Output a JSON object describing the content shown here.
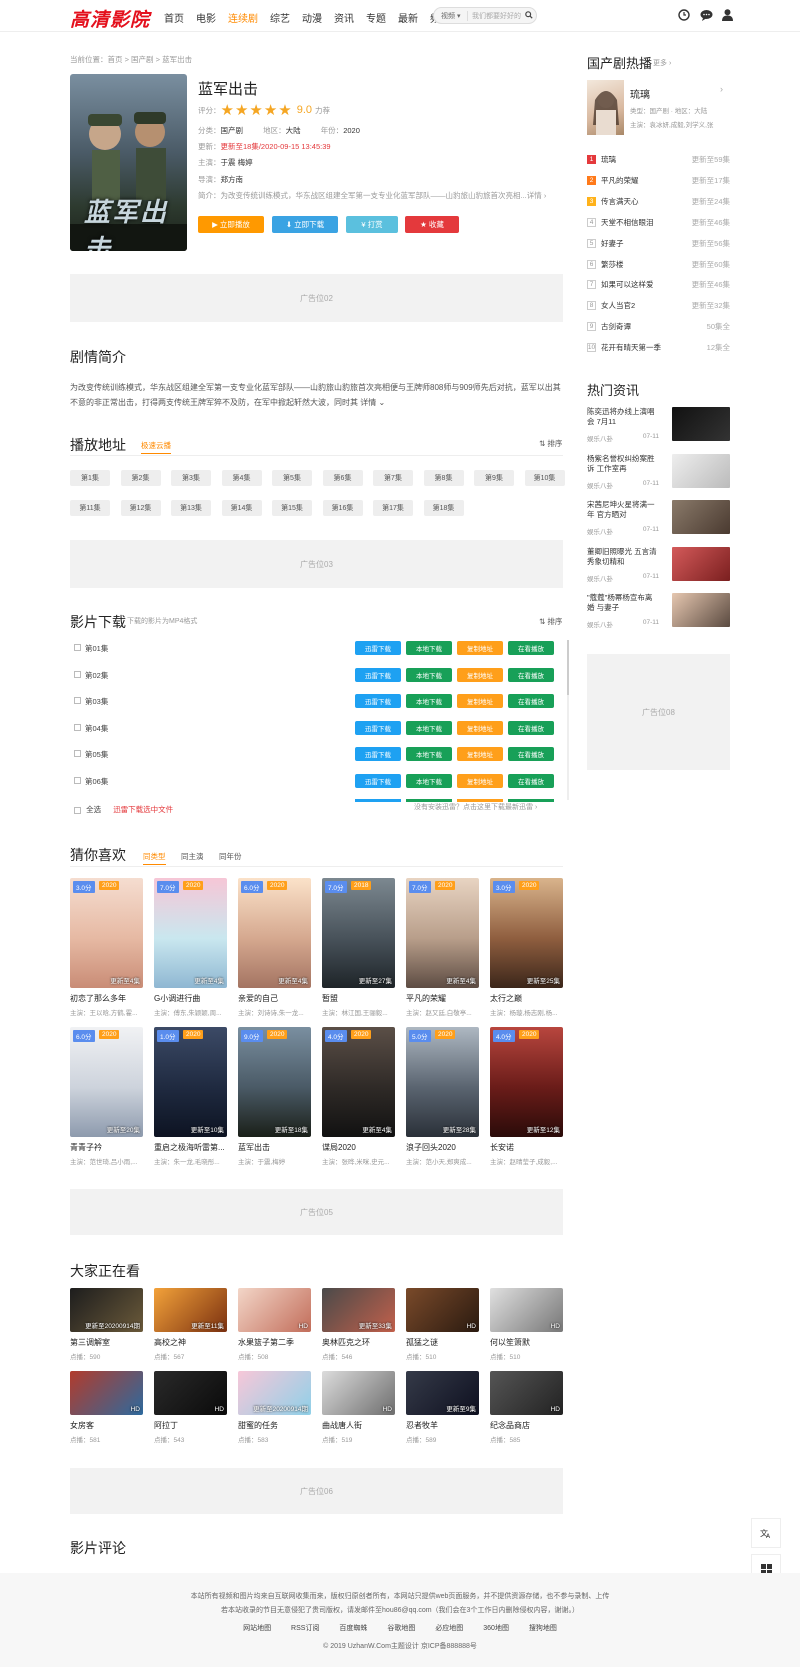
{
  "header": {
    "logo": "高清影院",
    "nav": [
      "首页",
      "电影",
      "连续剧",
      "综艺",
      "动漫",
      "资讯",
      "专题",
      "最新",
      "频道"
    ],
    "search_type": "视频",
    "search_placeholder": "我们都要好好的"
  },
  "breadcrumb": {
    "text": "当前位置：首页 > 国产剧 > 蓝军出击"
  },
  "movie": {
    "title": "蓝军出击",
    "rating_label": "评分：",
    "score": "9.0",
    "score_suffix": "力荐",
    "stars_filled": 5,
    "category_label": "分类：",
    "category": "国产剧",
    "region_label": "地区：",
    "region": "大陆",
    "year_label": "年份：",
    "year": "2020",
    "update_label": "更新：",
    "update": "更新至18集/2020-09-15 13:45:39",
    "cast_label": "主演：",
    "cast": "于震 梅婷",
    "director_label": "导演：",
    "director": "郑方南",
    "intro_label": "简介：",
    "intro": "为改变传统训练模式，华东战区组建全军第一支专业化蓝军部队——山豹旅山豹旅首次亮相...详情 ›",
    "poster_title": "蓝军出击"
  },
  "buttons": {
    "play": "▶ 立即播放",
    "download": "⬇ 立即下载",
    "tip": "¥ 打赏",
    "fav": "★ 收藏"
  },
  "ads": {
    "ad02": "广告位02",
    "ad03": "广告位03",
    "ad05": "广告位05",
    "ad06": "广告位06",
    "ad08": "广告位08"
  },
  "synopsis": {
    "heading": "剧情简介",
    "text": "为改变传统训练模式，华东战区组建全军第一支专业化蓝军部队——山豹旅山豹旅首次亮相便与王牌师808师与909师先后对抗，蓝军以出其不意的非正常出击，打得两支传统王牌军猝不及防，在军中掀起轩然大波，同时其 详情 ⌄"
  },
  "play": {
    "heading": "播放地址",
    "source": "极速云播",
    "sort": "⇅ 排序",
    "episodes": [
      "第1集",
      "第2集",
      "第3集",
      "第4集",
      "第5集",
      "第6集",
      "第7集",
      "第8集",
      "第9集",
      "第10集",
      "第11集",
      "第12集",
      "第13集",
      "第14集",
      "第15集",
      "第16集",
      "第17集",
      "第18集"
    ]
  },
  "download": {
    "heading": "影片下载",
    "note": "下载的影片为MP4格式",
    "sort": "⇅ 排序",
    "items": [
      "第01集",
      "第02集",
      "第03集",
      "第04集",
      "第05集",
      "第06集"
    ],
    "btn_xl": "迅雷下载",
    "btn_local": "本地下载",
    "btn_copy": "复制地址",
    "btn_watch": "在看播放",
    "select_all": "全选",
    "batch": "迅雷下载选中文件",
    "footer_note": "没有安装迅雷？点击这里下载最新迅雷 ›"
  },
  "guess": {
    "heading": "猜你喜欢",
    "tabs": [
      "同类型",
      "同主演",
      "同年份"
    ],
    "items": [
      {
        "score": "3.0分",
        "year": "2020",
        "status": "更新至4集",
        "name": "初恋了那么多年",
        "actors": "主演：王以晗,方鹤,霍..."
      },
      {
        "score": "7.0分",
        "year": "2020",
        "status": "更新至4集",
        "name": "G小调进行曲",
        "actors": "主演：傅东,朱颖颖,周..."
      },
      {
        "score": "6.0分",
        "year": "2020",
        "status": "更新至4集",
        "name": "亲爱的自己",
        "actors": "主演：刘诗诗,朱一龙..."
      },
      {
        "score": "7.0分",
        "year": "2018",
        "status": "更新至27集",
        "name": "暂盟",
        "actors": "主演：林江国,王骊毅..."
      },
      {
        "score": "7.0分",
        "year": "2020",
        "status": "更新至4集",
        "name": "平凡的荣耀",
        "actors": "主演：赵又廷,白敬亭..."
      },
      {
        "score": "3.0分",
        "year": "2020",
        "status": "更新至25集",
        "name": "太行之巅",
        "actors": "主演：杨璇,杨志刚,杨..."
      },
      {
        "score": "6.0分",
        "year": "2020",
        "status": "更新至20集",
        "name": "青青子衿",
        "actors": "主演：范世琦,吕小雨,..."
      },
      {
        "score": "1.0分",
        "year": "2020",
        "status": "更新至10集",
        "name": "重启之极海听雷第...",
        "actors": "主演：朱一龙,毛晓彤..."
      },
      {
        "score": "9.0分",
        "year": "2020",
        "status": "更新至18集",
        "name": "蓝军出击",
        "actors": "主演：于震,梅婷"
      },
      {
        "score": "4.0分",
        "year": "2020",
        "status": "更新至4集",
        "name": "谍局2020",
        "actors": "主演：张晔,米咪,史元..."
      },
      {
        "score": "5.0分",
        "year": "2020",
        "status": "更新至28集",
        "name": "浪子回头2020",
        "actors": "主演：范小天,郑爽成..."
      },
      {
        "score": "4.0分",
        "year": "2020",
        "status": "更新至12集",
        "name": "长安诺",
        "actors": "主演：赵晴莹子,成毅,..."
      }
    ]
  },
  "watching": {
    "heading": "大家正在看",
    "items": [
      {
        "status": "更新至20200914期",
        "name": "第三调解室",
        "plays": "点播：590"
      },
      {
        "status": "更新至11集",
        "name": "高校之神",
        "plays": "点播：567"
      },
      {
        "status": "HD",
        "name": "水果篮子第二季",
        "plays": "点播：508"
      },
      {
        "status": "更新至33集",
        "name": "奥林匹克之环",
        "plays": "点播：546"
      },
      {
        "status": "HD",
        "name": "孤猛之谜",
        "plays": "点播：510"
      },
      {
        "status": "HD",
        "name": "何以笙箫默",
        "plays": "点播：510"
      },
      {
        "status": "HD",
        "name": "女房客",
        "plays": "点播：581"
      },
      {
        "status": "HD",
        "name": "阿拉丁",
        "plays": "点播：543"
      },
      {
        "status": "更新至20200914期",
        "name": "甜蜜的任务",
        "plays": "点播：583"
      },
      {
        "status": "HD",
        "name": "曲战唐人街",
        "plays": "点播：519"
      },
      {
        "status": "更新至9集",
        "name": "忍者牧羊",
        "plays": "点播：589"
      },
      {
        "status": "HD",
        "name": "纪念品商店",
        "plays": "点播：585"
      }
    ]
  },
  "comments": {
    "heading": "影片评论"
  },
  "sidebar": {
    "hot_heading": "国产剧热播",
    "more": "更多 ›",
    "featured": {
      "name": "琉璃",
      "type": "类型：国产剧 · 地区：大陆",
      "cast": "主演：袁冰妍,成毅,刘学义,张"
    },
    "ranks": [
      {
        "n": "1",
        "t": "琉璃",
        "u": "更新至59集"
      },
      {
        "n": "2",
        "t": "平凡的荣耀",
        "u": "更新至17集"
      },
      {
        "n": "3",
        "t": "传言满天心",
        "u": "更新至24集"
      },
      {
        "n": "4",
        "t": "天堂不相信眼泪",
        "u": "更新至46集"
      },
      {
        "n": "5",
        "t": "好妻子",
        "u": "更新至56集"
      },
      {
        "n": "6",
        "t": "繁莎楼",
        "u": "更新至60集"
      },
      {
        "n": "7",
        "t": "如果可以这样爱",
        "u": "更新至46集"
      },
      {
        "n": "8",
        "t": "女人当官2",
        "u": "更新至32集"
      },
      {
        "n": "9",
        "t": "古剑奇谭",
        "u": "50集全"
      },
      {
        "n": "10",
        "t": "花开有晴天第一季",
        "u": "12集全"
      }
    ],
    "news_heading": "热门资讯",
    "news": [
      {
        "t": "陈奕迅将办线上演唱会 7月11",
        "m": "娱乐八卦",
        "d": "07-11"
      },
      {
        "t": "杨紫名誉权纠纷案胜诉 工作室再",
        "m": "娱乐八卦",
        "d": "07-11"
      },
      {
        "t": "宋茜尼坤火星将满一年 官方晒对",
        "m": "娱乐八卦",
        "d": "07-11"
      },
      {
        "t": "董卿旧照曝光 五言清秀象切精和",
        "m": "娱乐八卦",
        "d": "07-11"
      },
      {
        "t": "\"蔻蔻\"杨幂杨宣布离婚 与妻子",
        "m": "娱乐八卦",
        "d": "07-11"
      }
    ]
  },
  "footer": {
    "l1": "本站所有视频和图片均来自互联网收集而来，版权归原创者所有，本网站只提供web页面服务，并不提供资源存储，也不参与录制、上传",
    "l2": "若本站收录的节目无意侵犯了贵司版权，请发邮件至hou86@qq.com（我们会在3个工作日内删除侵权内容，谢谢。）",
    "links": [
      "网站地图",
      "RSS订阅",
      "百度蜘蛛",
      "谷歌地图",
      "必应地图",
      "360地图",
      "搜狗地图"
    ],
    "copyright": "© 2019 UzhanW.Com主题设计  京ICP备888888号"
  }
}
